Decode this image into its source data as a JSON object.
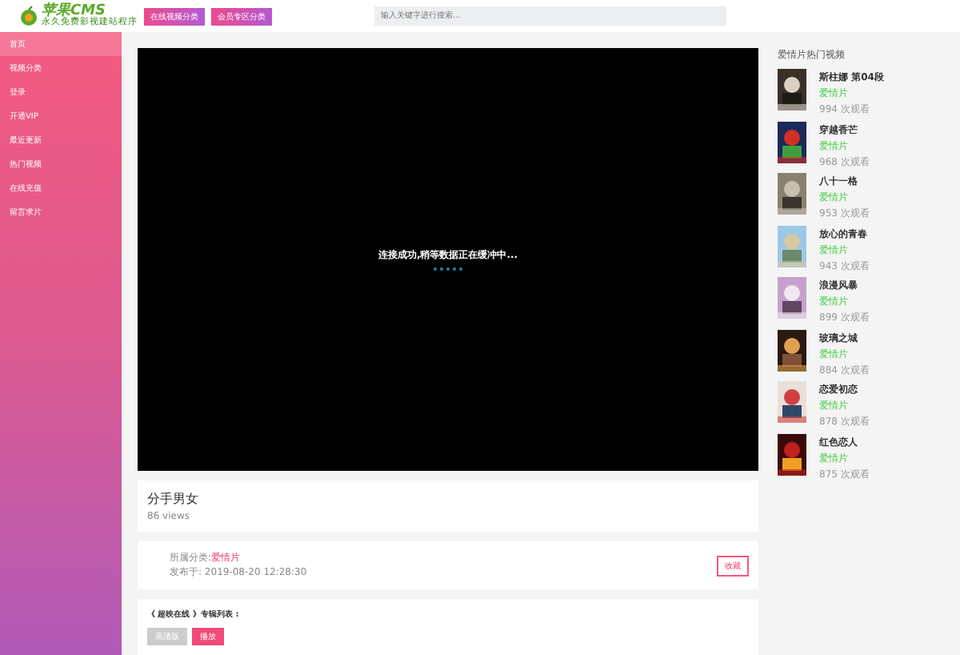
{
  "header": {
    "logo": "苹果CMS",
    "logo_tagline": "永久免费影视建站程序",
    "nav_buttons": [
      "在线视频分类",
      "会员专区分类"
    ],
    "search": {
      "placeholder": "输入关键字进行搜索..."
    }
  },
  "sidebar": {
    "items": [
      {
        "label": "首页",
        "selected": true
      },
      {
        "label": "视频分类",
        "selected": false
      },
      {
        "label": "登录",
        "selected": false
      },
      {
        "label": "开通VIP",
        "selected": false
      },
      {
        "label": "最近更新",
        "selected": false
      },
      {
        "label": "热门视频",
        "selected": false
      },
      {
        "label": "在线充值",
        "selected": false
      },
      {
        "label": "留言求片",
        "selected": false
      }
    ]
  },
  "player": {
    "message": "连接成功,稍等数据正在缓冲中..."
  },
  "video": {
    "title": "分手男女",
    "views": "86 views"
  },
  "info": {
    "category_label": "所属分类:",
    "category": "爱情片",
    "published": "发布于: 2019-08-20 12:28:30",
    "favorite_button": "收藏"
  },
  "album": {
    "title": "《 超映在线 》专辑列表 :",
    "buttons": [
      {
        "label": "高清版",
        "selected": false
      },
      {
        "label": "播放",
        "selected": true
      }
    ]
  },
  "hot": {
    "title": "爱情片热门视频",
    "items": [
      {
        "title": "斯柱娜 第04段",
        "category": "爱情片",
        "views": "994 次观看"
      },
      {
        "title": "穿越香芒",
        "category": "爱情片",
        "views": "968 次观看"
      },
      {
        "title": "八十一格",
        "category": "爱情片",
        "views": "953 次观看"
      },
      {
        "title": "放心的青春",
        "category": "爱情片",
        "views": "943 次观看"
      },
      {
        "title": "浪漫风暴",
        "category": "爱情片",
        "views": "899 次观看"
      },
      {
        "title": "玻璃之城",
        "category": "爱情片",
        "views": "884 次观看"
      },
      {
        "title": "恋爱初恋",
        "category": "爱情片",
        "views": "878 次观看"
      },
      {
        "title": "红色恋人",
        "category": "爱情片",
        "views": "875 次观看"
      }
    ]
  }
}
